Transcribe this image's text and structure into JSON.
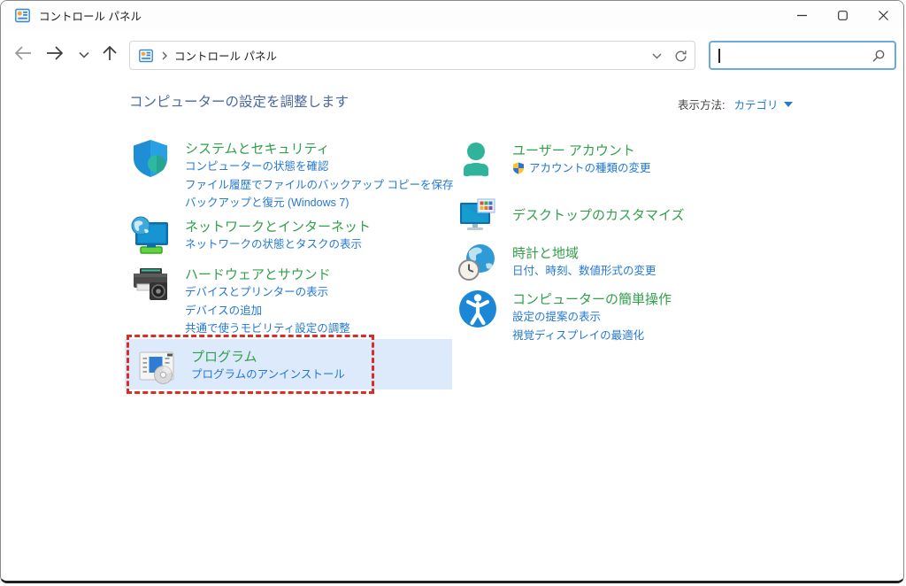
{
  "window": {
    "title": "コントロール パネル",
    "controls": {
      "minimize": "minimize",
      "maximize": "maximize",
      "close": "close"
    }
  },
  "toolbar": {
    "nav": [
      "back",
      "forward",
      "recent-locations",
      "up"
    ],
    "address": {
      "breadcrumb_root": "コントロール パネル",
      "separator": "›"
    },
    "search": {
      "value": "",
      "placeholder": ""
    }
  },
  "header": {
    "title": "コンピューターの設定を調整します",
    "view_label": "表示方法:",
    "view_value": "カテゴリ"
  },
  "categories": {
    "left": [
      {
        "title": "システムとセキュリティ",
        "icon": "shield-icon",
        "links": [
          "コンピューターの状態を確認",
          "ファイル履歴でファイルのバックアップ コピーを保存",
          "バックアップと復元 (Windows 7)"
        ]
      },
      {
        "title": "ネットワークとインターネット",
        "icon": "network-icon",
        "links": [
          "ネットワークの状態とタスクの表示"
        ]
      },
      {
        "title": "ハードウェアとサウンド",
        "icon": "printer-sound-icon",
        "links": [
          "デバイスとプリンターの表示",
          "デバイスの追加",
          "共通で使うモビリティ設定の調整"
        ]
      },
      {
        "title": "プログラム",
        "icon": "programs-icon",
        "highlighted": true,
        "links": [
          "プログラムのアンインストール"
        ]
      }
    ],
    "right": [
      {
        "title": "ユーザー アカウント",
        "icon": "user-icon",
        "uac_shield_on_link": true,
        "links": [
          "アカウントの種類の変更"
        ]
      },
      {
        "title": "デスクトップのカスタマイズ",
        "icon": "desktop-icon",
        "links": []
      },
      {
        "title": "時計と地域",
        "icon": "clock-globe-icon",
        "links": [
          "日付、時刻、数値形式の変更"
        ]
      },
      {
        "title": "コンピューターの簡単操作",
        "icon": "accessibility-icon",
        "links": [
          "設定の提案の表示",
          "視覚ディスプレイの最適化"
        ]
      }
    ]
  },
  "colors": {
    "category_title_green": "#32A04B",
    "task_link_blue": "#2478d4",
    "heading_blue": "#4a68a0",
    "highlight_background": "#dceafb",
    "annotation_red": "#d92d26",
    "search_focus_border": "#6aabdd"
  }
}
